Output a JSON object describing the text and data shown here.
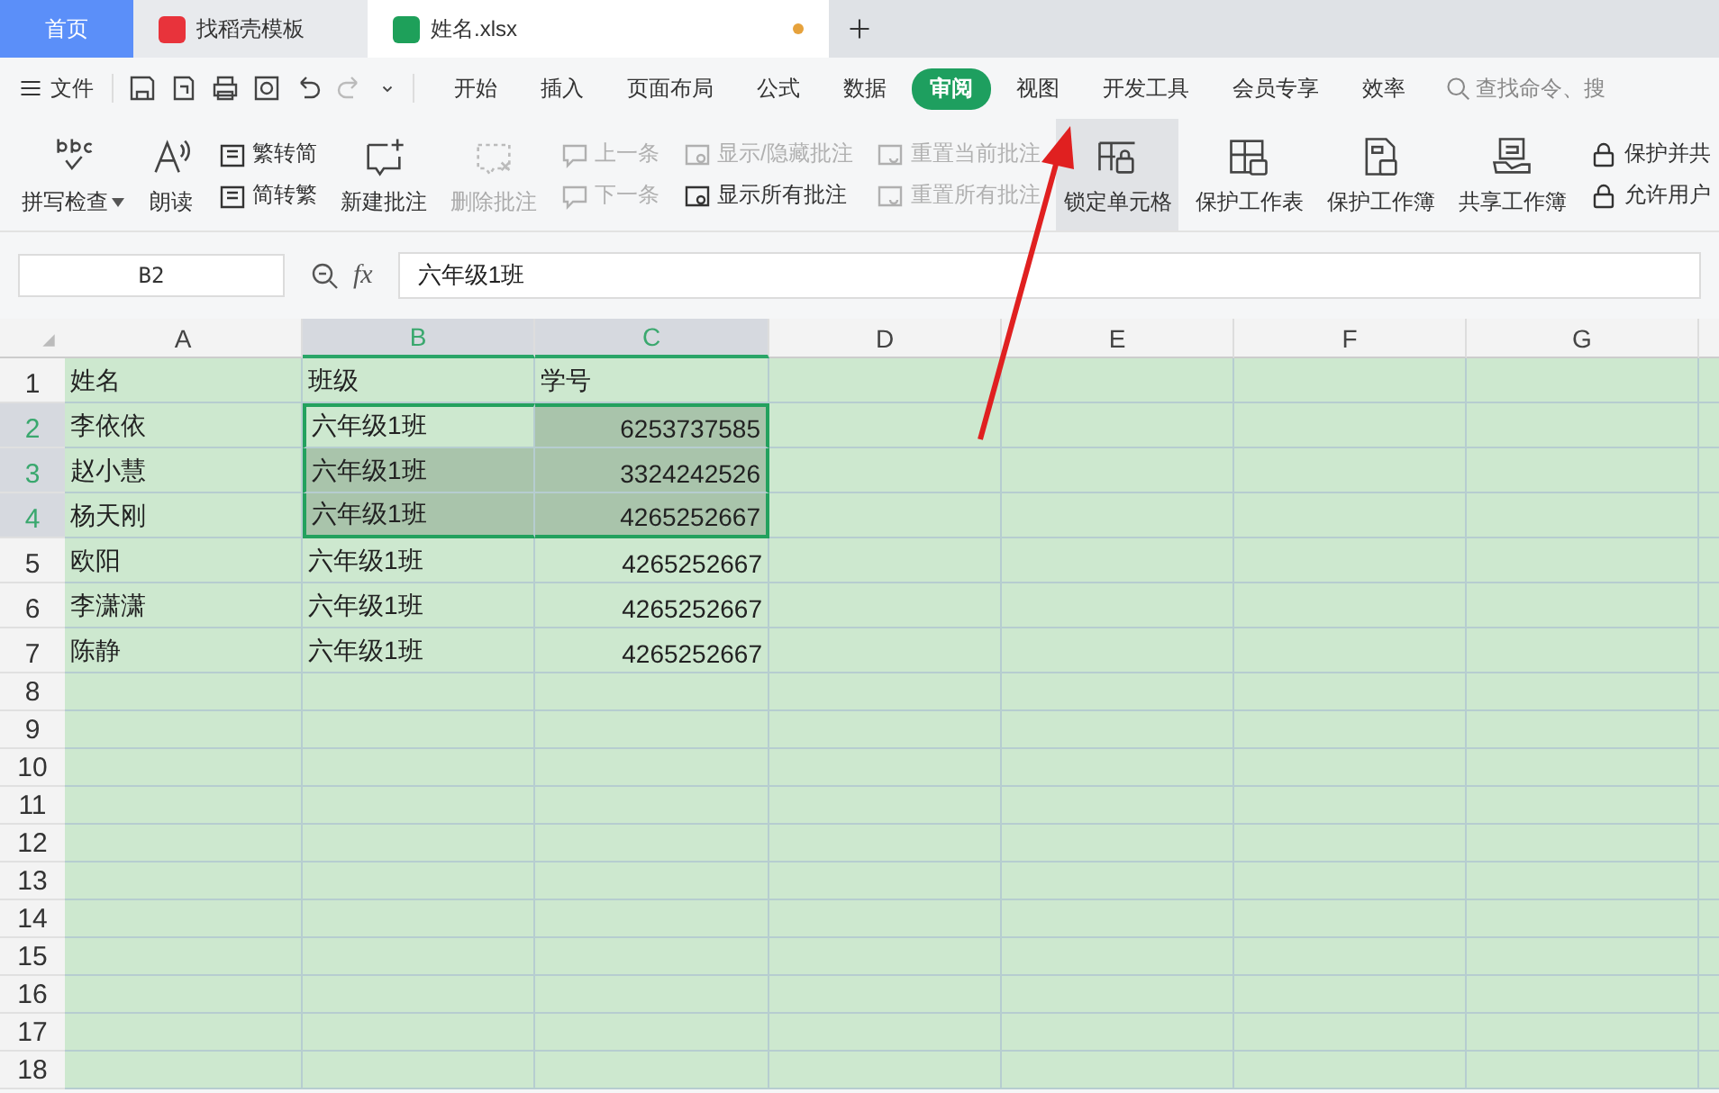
{
  "tabs": [
    {
      "label": "首页",
      "kind": "home",
      "selected": false
    },
    {
      "label": "找稻壳模板",
      "kind": "docer",
      "selected": false
    },
    {
      "label": "姓名.xlsx",
      "kind": "sheet",
      "selected": true
    }
  ],
  "menu": {
    "file": "文件",
    "ribbon_tabs": [
      {
        "label": "开始",
        "selected": false
      },
      {
        "label": "插入",
        "selected": false
      },
      {
        "label": "页面布局",
        "selected": false
      },
      {
        "label": "公式",
        "selected": false
      },
      {
        "label": "数据",
        "selected": false
      },
      {
        "label": "审阅",
        "selected": true
      },
      {
        "label": "视图",
        "selected": false
      },
      {
        "label": "开发工具",
        "selected": false
      },
      {
        "label": "会员专享",
        "selected": false
      },
      {
        "label": "效率",
        "selected": false
      }
    ],
    "search": {
      "placeholder": "查找命令、搜"
    }
  },
  "ribbon": [
    {
      "kind": "large",
      "label": "拼写检查",
      "dropdown": true,
      "disabled": false,
      "selected": false
    },
    {
      "kind": "large",
      "label": "朗读",
      "dropdown": false,
      "disabled": false,
      "selected": false
    },
    {
      "kind": "stack",
      "items": [
        {
          "label": "繁转简",
          "disabled": false
        },
        {
          "label": "简转繁",
          "disabled": false
        }
      ]
    },
    {
      "kind": "large",
      "label": "新建批注",
      "dropdown": false,
      "disabled": false,
      "selected": false
    },
    {
      "kind": "large",
      "label": "删除批注",
      "dropdown": false,
      "disabled": true,
      "selected": false
    },
    {
      "kind": "stack",
      "items": [
        {
          "label": "上一条",
          "disabled": true
        },
        {
          "label": "下一条",
          "disabled": true
        }
      ]
    },
    {
      "kind": "stack",
      "items": [
        {
          "label": "显示/隐藏批注",
          "disabled": true
        },
        {
          "label": "显示所有批注",
          "disabled": false
        }
      ]
    },
    {
      "kind": "stack",
      "items": [
        {
          "label": "重置当前批注",
          "disabled": true
        },
        {
          "label": "重置所有批注",
          "disabled": true
        }
      ]
    },
    {
      "kind": "large",
      "label": "锁定单元格",
      "dropdown": false,
      "disabled": false,
      "selected": true
    },
    {
      "kind": "large",
      "label": "保护工作表",
      "dropdown": false,
      "disabled": false,
      "selected": false
    },
    {
      "kind": "large",
      "label": "保护工作簿",
      "dropdown": false,
      "disabled": false,
      "selected": false
    },
    {
      "kind": "large",
      "label": "共享工作簿",
      "dropdown": false,
      "disabled": false,
      "selected": false
    },
    {
      "kind": "stack",
      "items": [
        {
          "label": "保护并共",
          "disabled": false
        },
        {
          "label": "允许用户",
          "disabled": false
        }
      ]
    }
  ],
  "formula_bar": {
    "name_box": "B2",
    "function_label": "fx",
    "value": "六年级1班"
  },
  "sheet": {
    "columns": [
      {
        "label": "A",
        "selected": false
      },
      {
        "label": "B",
        "selected": true
      },
      {
        "label": "C",
        "selected": true
      },
      {
        "label": "D",
        "selected": false
      },
      {
        "label": "E",
        "selected": false
      },
      {
        "label": "F",
        "selected": false
      },
      {
        "label": "G",
        "selected": false
      }
    ],
    "rows": [
      {
        "number": "1",
        "selected": false,
        "cells": [
          {
            "text": "姓名",
            "kind": "text",
            "selected": false
          },
          {
            "text": "班级",
            "kind": "text",
            "selected": false
          },
          {
            "text": "学号",
            "kind": "text",
            "selected": false
          }
        ]
      },
      {
        "number": "2",
        "selected": true,
        "cells": [
          {
            "text": "李依依",
            "kind": "text",
            "selected": false
          },
          {
            "text": "六年级1班",
            "kind": "text",
            "selected": false
          },
          {
            "text": "6253737585",
            "kind": "number",
            "selected": true
          }
        ]
      },
      {
        "number": "3",
        "selected": true,
        "cells": [
          {
            "text": "赵小慧",
            "kind": "text",
            "selected": false
          },
          {
            "text": "六年级1班",
            "kind": "text",
            "selected": true
          },
          {
            "text": "3324242526",
            "kind": "number",
            "selected": true
          }
        ]
      },
      {
        "number": "4",
        "selected": true,
        "cells": [
          {
            "text": "杨天刚",
            "kind": "text",
            "selected": false
          },
          {
            "text": "六年级1班",
            "kind": "text",
            "selected": true
          },
          {
            "text": "4265252667",
            "kind": "number",
            "selected": true
          }
        ]
      },
      {
        "number": "5",
        "selected": false,
        "cells": [
          {
            "text": "欧阳",
            "kind": "text",
            "selected": false
          },
          {
            "text": "六年级1班",
            "kind": "text",
            "selected": false
          },
          {
            "text": "4265252667",
            "kind": "number",
            "selected": false
          }
        ]
      },
      {
        "number": "6",
        "selected": false,
        "cells": [
          {
            "text": "李潇潇",
            "kind": "text",
            "selected": false
          },
          {
            "text": "六年级1班",
            "kind": "text",
            "selected": false
          },
          {
            "text": "4265252667",
            "kind": "number",
            "selected": false
          }
        ]
      },
      {
        "number": "7",
        "selected": false,
        "cells": [
          {
            "text": "陈静",
            "kind": "text",
            "selected": false
          },
          {
            "text": "六年级1班",
            "kind": "text",
            "selected": false
          },
          {
            "text": "4265252667",
            "kind": "number",
            "selected": false
          }
        ]
      },
      {
        "number": "8",
        "selected": false
      },
      {
        "number": "9",
        "selected": false
      },
      {
        "number": "10",
        "selected": false
      },
      {
        "number": "11",
        "selected": false
      },
      {
        "number": "12",
        "selected": false
      },
      {
        "number": "13",
        "selected": false
      },
      {
        "number": "14",
        "selected": false
      },
      {
        "number": "15",
        "selected": false
      },
      {
        "number": "16",
        "selected": false
      },
      {
        "number": "17",
        "selected": false
      },
      {
        "number": "18",
        "selected": false
      }
    ]
  }
}
